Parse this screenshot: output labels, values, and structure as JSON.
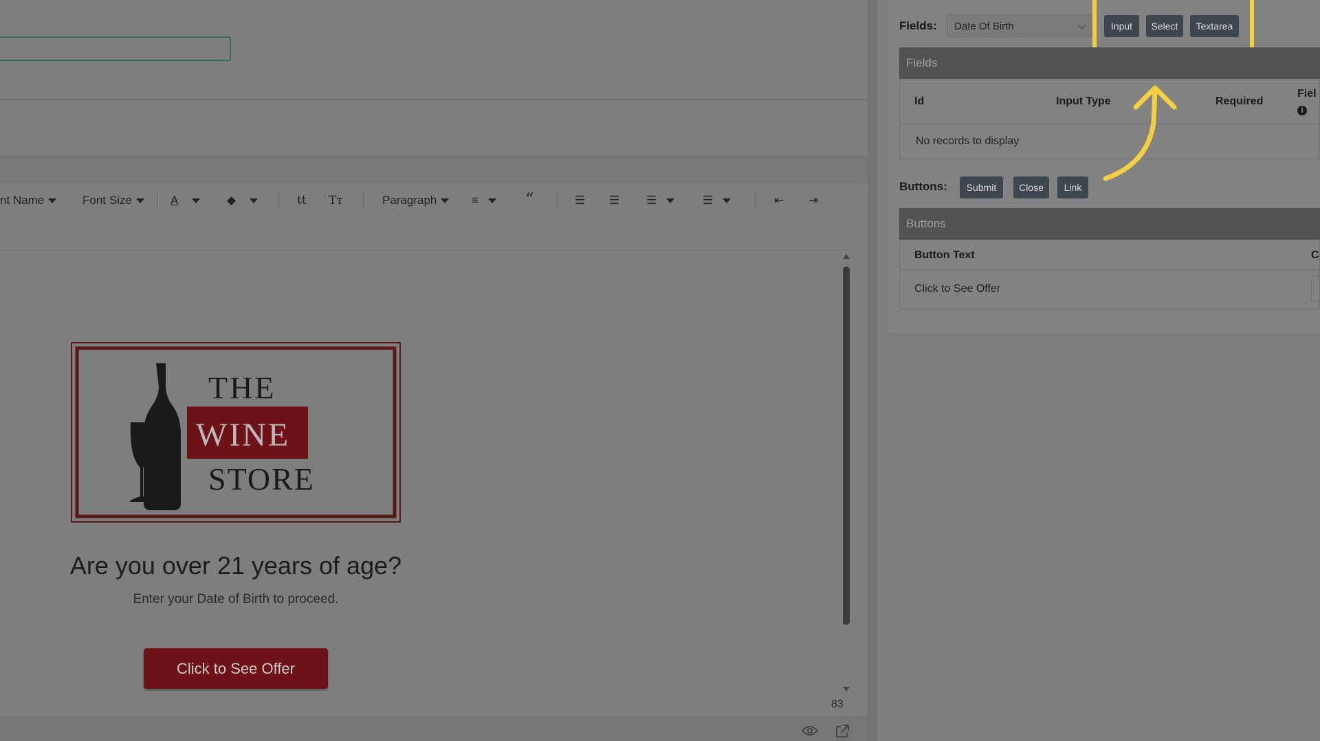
{
  "editor": {
    "toolbar": {
      "font_name": "nt Name",
      "font_size": "Font Size",
      "paragraph": "Paragraph",
      "lower_case_glyph": "tt",
      "title_case_glyph": "Tт"
    },
    "word_count": "83"
  },
  "popup": {
    "logo": {
      "line1": "THE",
      "line2": "WINE",
      "line3": "STORE",
      "brand_color": "#6f1218"
    },
    "headline": "Are you over 21 years of age?",
    "subtext": "Enter your Date of Birth to proceed.",
    "button_label": "Click to See Offer"
  },
  "panel": {
    "fields_label": "Fields:",
    "fields_select_value": "Date Of Birth",
    "add_buttons": [
      "Input",
      "Select",
      "Textarea"
    ],
    "fields_grid": {
      "title": "Fields",
      "columns": [
        "Id",
        "Input Type",
        "Required",
        "Fiel"
      ],
      "empty_text": "No records to display"
    },
    "buttons_label": "Buttons:",
    "button_types": [
      "Submit",
      "Close",
      "Link"
    ],
    "buttons_grid": {
      "title": "Buttons",
      "columns": [
        "Button Text",
        "C"
      ],
      "rows": [
        [
          "Click to See Offer"
        ]
      ]
    },
    "highlight_color": "#f4cf41"
  }
}
